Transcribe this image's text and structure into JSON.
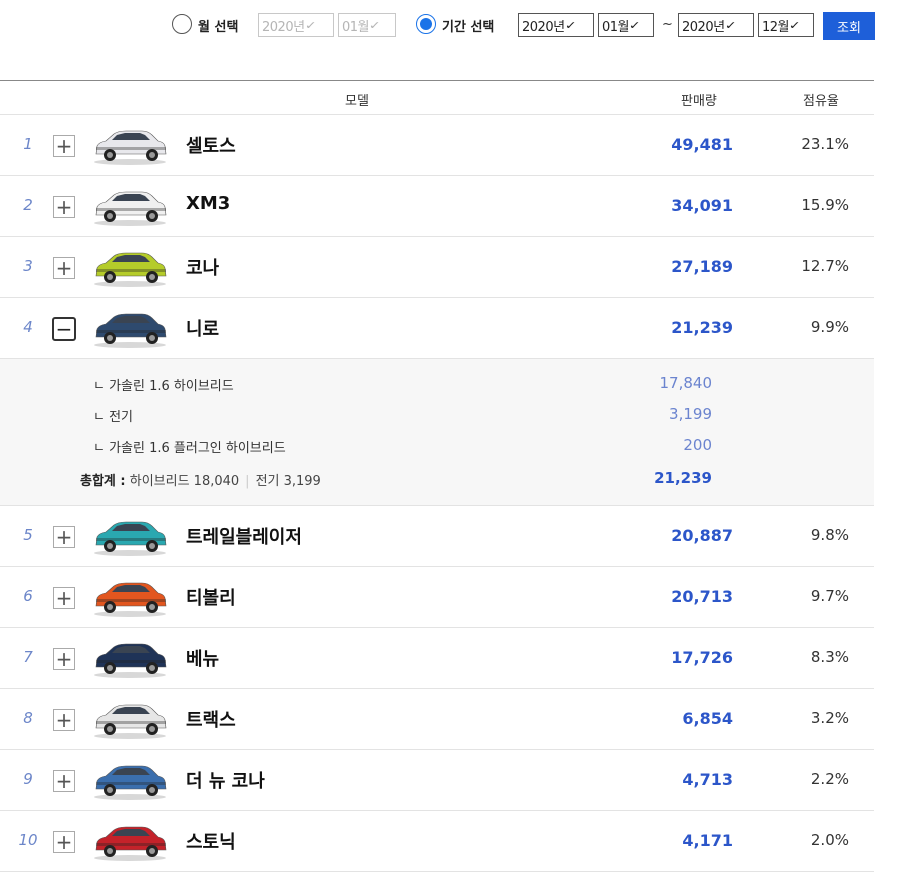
{
  "filter": {
    "month_option_label": "월 선택",
    "month_year": "2020년",
    "month_month": "01월",
    "period_option_label": "기간 선택",
    "from_year": "2020년",
    "from_month": "01월",
    "separator": "~",
    "to_year": "2020년",
    "to_month": "12월",
    "search_button": "조회"
  },
  "table": {
    "headers": {
      "model": "모델",
      "sales": "판매량",
      "share": "점유율"
    },
    "rows": [
      {
        "rank": "1",
        "model": "셀토스",
        "sales": "49,481",
        "share": "23.1%",
        "expanded": false,
        "car_color": "#e8e8ec"
      },
      {
        "rank": "2",
        "model": "XM3",
        "sales": "34,091",
        "share": "15.9%",
        "expanded": false,
        "car_color": "#f0f0f0"
      },
      {
        "rank": "3",
        "model": "코나",
        "sales": "27,189",
        "share": "12.7%",
        "expanded": false,
        "car_color": "#b5cc2a"
      },
      {
        "rank": "4",
        "model": "니로",
        "sales": "21,239",
        "share": "9.9%",
        "expanded": true,
        "car_color": "#2e4a6e"
      },
      {
        "rank": "5",
        "model": "트레일블레이저",
        "sales": "20,887",
        "share": "9.8%",
        "expanded": false,
        "car_color": "#2aa8b0"
      },
      {
        "rank": "6",
        "model": "티볼리",
        "sales": "20,713",
        "share": "9.7%",
        "expanded": false,
        "car_color": "#e2561f"
      },
      {
        "rank": "7",
        "model": "베뉴",
        "sales": "17,726",
        "share": "8.3%",
        "expanded": false,
        "car_color": "#1f3357"
      },
      {
        "rank": "8",
        "model": "트랙스",
        "sales": "6,854",
        "share": "3.2%",
        "expanded": false,
        "car_color": "#e6e6e6"
      },
      {
        "rank": "9",
        "model": "더 뉴 코나",
        "sales": "4,713",
        "share": "2.2%",
        "expanded": false,
        "car_color": "#3b6fae"
      },
      {
        "rank": "10",
        "model": "스토닉",
        "sales": "4,171",
        "share": "2.0%",
        "expanded": false,
        "car_color": "#c4222a"
      }
    ],
    "detail": {
      "items": [
        {
          "label": "ㄴ 가솔린 1.6 하이브리드",
          "value": "17,840"
        },
        {
          "label": "ㄴ 전기",
          "value": "3,199"
        },
        {
          "label": "ㄴ 가솔린 1.6 플러그인 하이브리드",
          "value": "200"
        }
      ],
      "summary_label": "총합계 :",
      "summary_hybrid": "하이브리드 18,040",
      "summary_separator": "|",
      "summary_ev": "전기 3,199",
      "total": "21,239"
    }
  },
  "icons": {
    "expand": "+",
    "collapse": "−",
    "chevron": "✓"
  }
}
